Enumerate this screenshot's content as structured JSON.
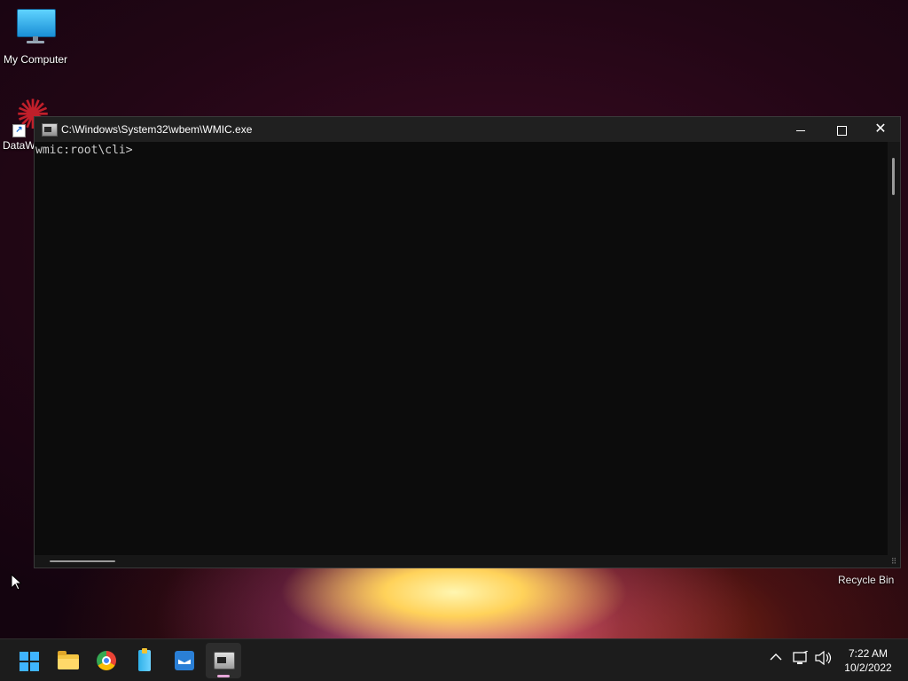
{
  "desktop": {
    "icons": [
      {
        "label": "My Computer"
      },
      {
        "label": "DataW"
      }
    ],
    "recycle_bin_label": "Recycle Bin"
  },
  "window": {
    "title": "C:\\Windows\\System32\\wbem\\WMIC.exe",
    "prompt": "wmic:root\\cli>",
    "controls": {
      "minimize": "minimize",
      "maximize": "maximize",
      "close": "✕"
    }
  },
  "taskbar": {
    "apps": [
      {
        "name": "start",
        "icon": "windows-logo-icon"
      },
      {
        "name": "file-explorer",
        "icon": "folder-icon"
      },
      {
        "name": "chrome",
        "icon": "chrome-icon"
      },
      {
        "name": "archiver",
        "icon": "archive-icon"
      },
      {
        "name": "mail",
        "icon": "mailbox-icon"
      },
      {
        "name": "wmic",
        "icon": "wmic-icon",
        "active": true
      }
    ],
    "tray": {
      "chevron": "^",
      "time": "7:22 AM",
      "date": "10/2/2022"
    }
  },
  "colors": {
    "accent_active": "#e6a6d8",
    "console_bg": "#0c0c0c",
    "console_text": "#cccccc",
    "taskbar_bg": "#1c1c1c"
  }
}
